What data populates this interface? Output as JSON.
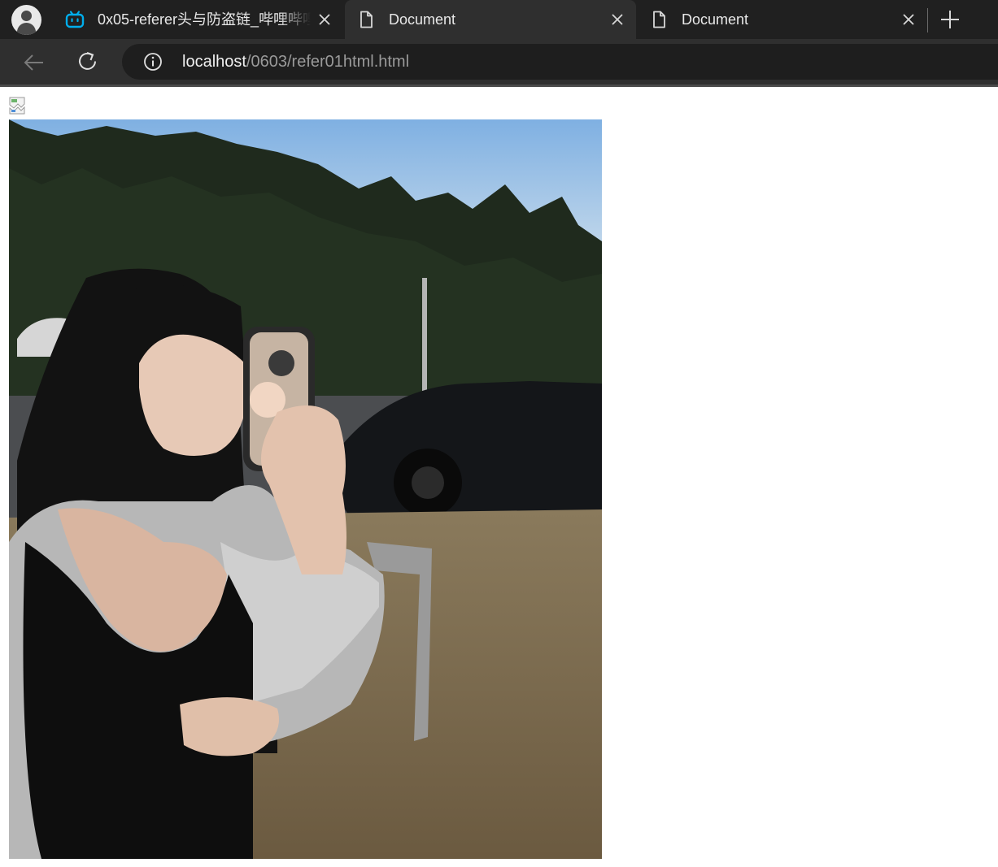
{
  "browser": {
    "tabs": [
      {
        "title": "0x05-referer头与防盗链_哔哩哔哩",
        "favicon": "bilibili-icon",
        "active": false
      },
      {
        "title": "Document",
        "favicon": "page-icon",
        "active": true
      },
      {
        "title": "Document",
        "favicon": "page-icon",
        "active": false
      }
    ],
    "address_bar": {
      "host": "localhost",
      "path": "/0603/refer01html.html",
      "icon": "info-icon"
    },
    "colors": {
      "tabstrip_bg": "#202020",
      "toolbar_bg": "#2f2f2f",
      "omnibox_bg": "#1e1e1e",
      "bilibili_blue": "#00aeec"
    }
  },
  "page": {
    "images": [
      {
        "state": "broken",
        "icon": "broken-image-icon"
      },
      {
        "state": "loaded",
        "subject": "photo"
      }
    ]
  }
}
